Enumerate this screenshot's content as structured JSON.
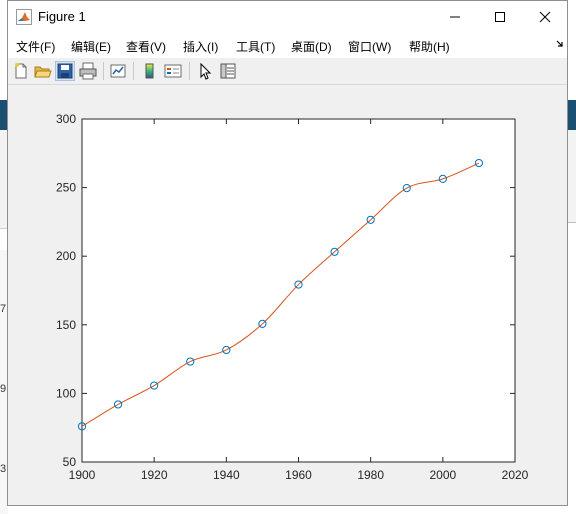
{
  "window": {
    "title": "Figure 1",
    "controls": [
      "minimize",
      "maximize",
      "close"
    ]
  },
  "menu": [
    {
      "label": "文件(F)"
    },
    {
      "label": "编辑(E)"
    },
    {
      "label": "查看(V)"
    },
    {
      "label": "插入(I)"
    },
    {
      "label": "工具(T)"
    },
    {
      "label": "桌面(D)"
    },
    {
      "label": "窗口(W)"
    },
    {
      "label": "帮助(H)"
    }
  ],
  "toolbar": {
    "icons": [
      "new-figure-icon",
      "open-file-icon",
      "save-icon",
      "print-icon",
      "link-plot-icon",
      "colorbar-icon",
      "legend-icon",
      "edit-plot-icon",
      "property-inspector-icon"
    ]
  },
  "background_fragments": [
    "7",
    "9",
    "3"
  ],
  "colors": {
    "line": "#d95319",
    "marker": "#0072bd",
    "axes_bg": "#ffffff",
    "figure_bg": "#f0f0f0"
  },
  "chart_data": {
    "type": "line",
    "title": "",
    "xlabel": "",
    "ylabel": "",
    "xlim": [
      1900,
      2020
    ],
    "ylim": [
      50,
      300
    ],
    "xticks": [
      "1900",
      "1920",
      "1940",
      "1960",
      "1980",
      "2000",
      "2020"
    ],
    "yticks": [
      "50",
      "100",
      "150",
      "200",
      "250",
      "300"
    ],
    "grid": false,
    "legend": "none",
    "series": [
      {
        "style": "markers",
        "marker": "circle",
        "x": [
          1900,
          1910,
          1920,
          1930,
          1940,
          1950,
          1960,
          1970,
          1980,
          1990,
          2000,
          2010
        ],
        "y": [
          75.995,
          91.972,
          105.711,
          123.203,
          131.669,
          150.697,
          179.323,
          203.212,
          226.505,
          249.633,
          256.344,
          267.893
        ]
      },
      {
        "style": "line",
        "interpolation": "spline",
        "x": [
          1900,
          1910,
          1920,
          1930,
          1940,
          1950,
          1960,
          1970,
          1980,
          1990,
          2000,
          2010
        ],
        "y": [
          75.995,
          91.972,
          105.711,
          123.203,
          131.669,
          150.697,
          179.323,
          203.212,
          226.505,
          249.633,
          256.344,
          267.893
        ]
      }
    ]
  }
}
